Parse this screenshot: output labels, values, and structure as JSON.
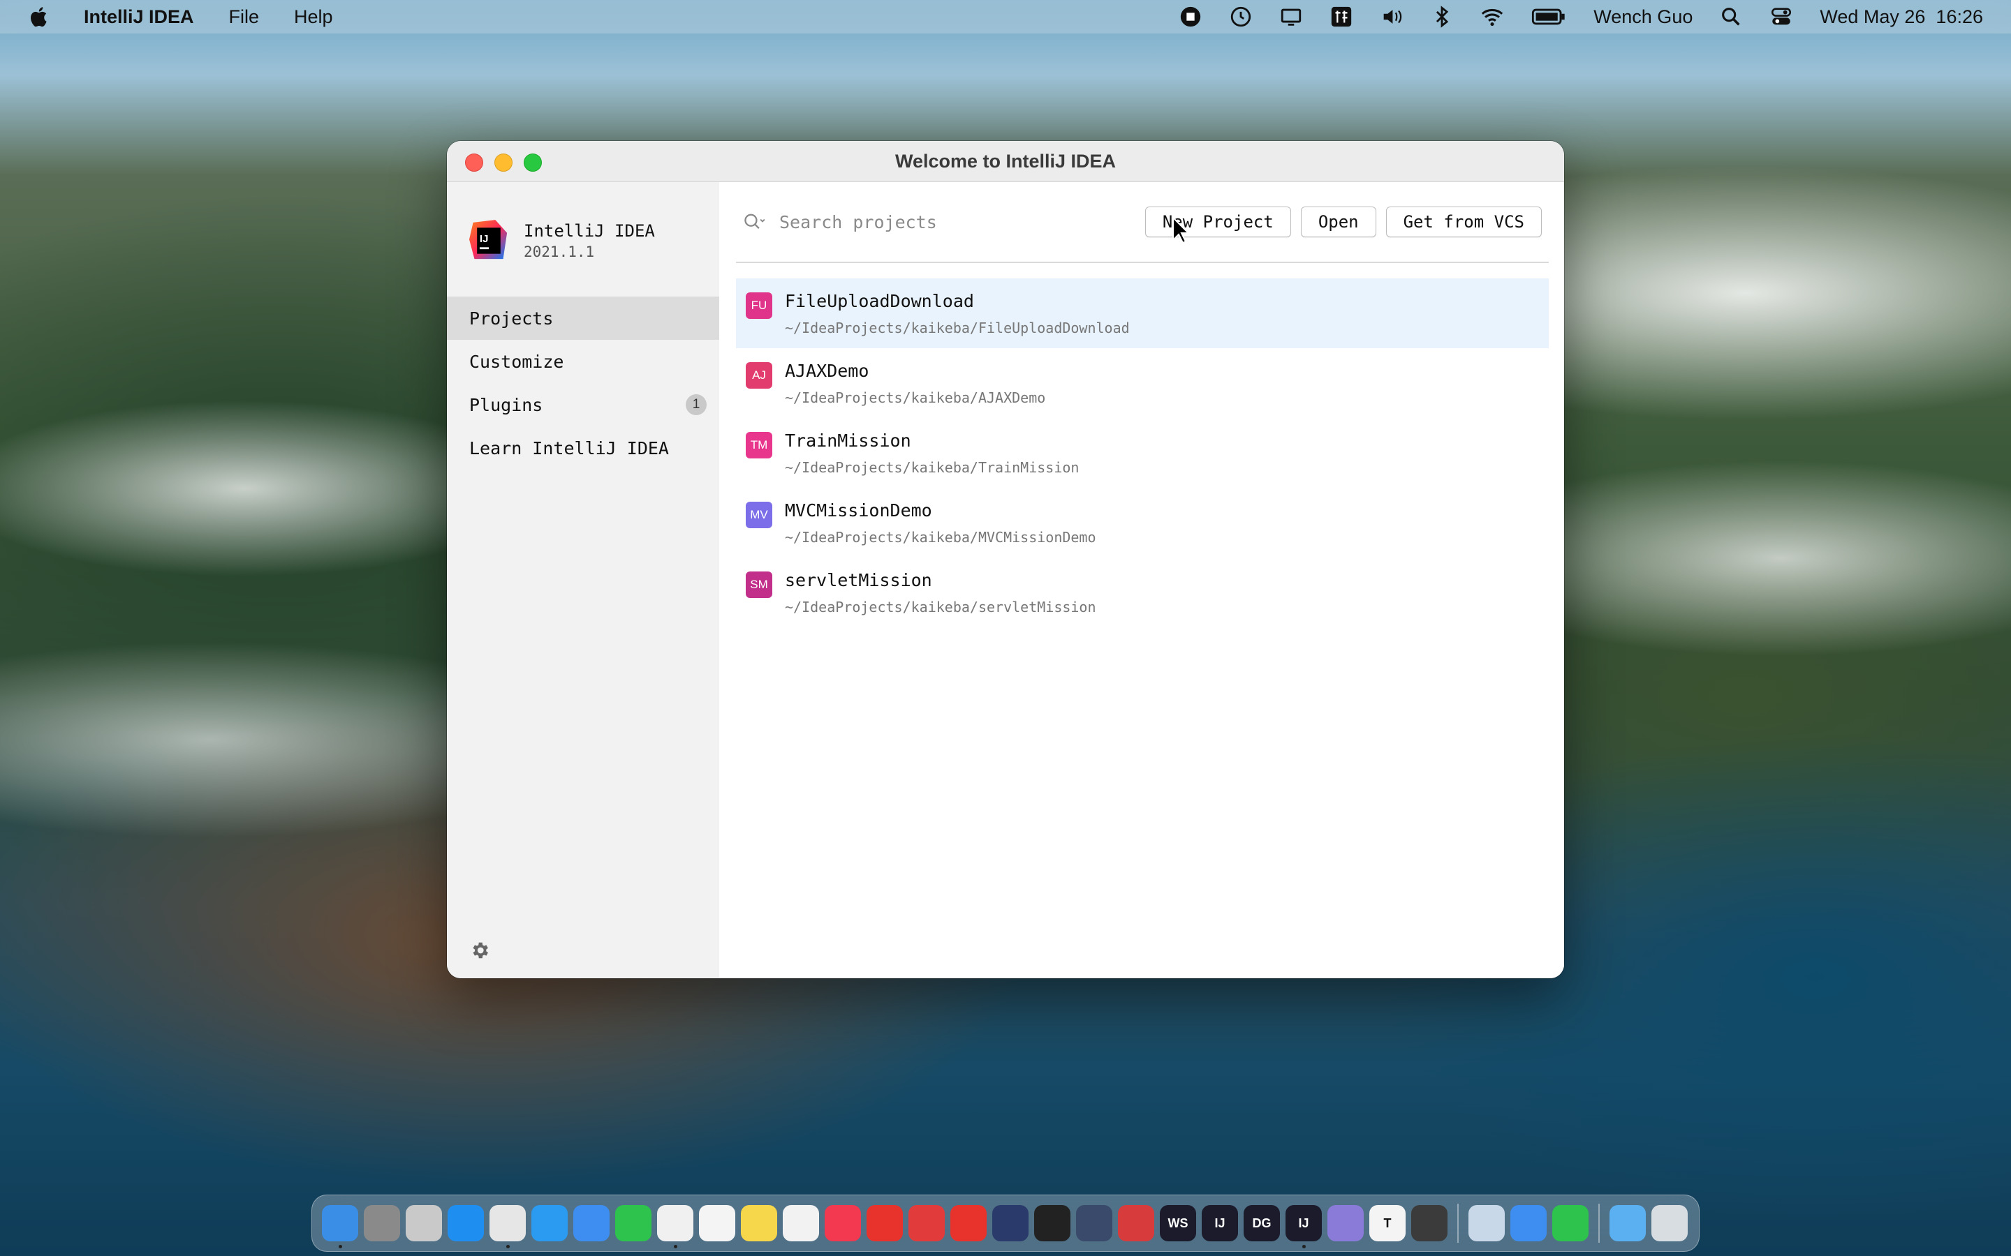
{
  "menubar": {
    "app_name": "IntelliJ IDEA",
    "menus": [
      "File",
      "Help"
    ],
    "user": "Wench Guo",
    "clock": "Wed May 26  16:26",
    "status_icons": [
      "record-stop-icon",
      "time-machine-icon",
      "display-icon",
      "input-method-icon",
      "volume-icon",
      "bluetooth-icon",
      "wifi-icon",
      "battery-icon",
      "spotlight-icon",
      "control-center-icon"
    ]
  },
  "window": {
    "title": "Welcome to IntelliJ IDEA"
  },
  "sidebar": {
    "product_name": "IntelliJ IDEA",
    "version": "2021.1.1",
    "items": [
      {
        "label": "Projects",
        "active": true
      },
      {
        "label": "Customize"
      },
      {
        "label": "Plugins",
        "badge": "1"
      },
      {
        "label": "Learn IntelliJ IDEA"
      }
    ]
  },
  "toolbar": {
    "search_placeholder": "Search projects",
    "new_project": "New Project",
    "open": "Open",
    "get_from_vcs": "Get from VCS"
  },
  "projects": [
    {
      "initials": "FU",
      "name": "FileUploadDownload",
      "path": "~/IdeaProjects/kaikeba/FileUploadDownload",
      "color": "#e0338a",
      "selected": true
    },
    {
      "initials": "AJ",
      "name": "AJAXDemo",
      "path": "~/IdeaProjects/kaikeba/AJAXDemo",
      "color": "#e23c6e"
    },
    {
      "initials": "TM",
      "name": "TrainMission",
      "path": "~/IdeaProjects/kaikeba/TrainMission",
      "color": "#e8368d"
    },
    {
      "initials": "MV",
      "name": "MVCMissionDemo",
      "path": "~/IdeaProjects/kaikeba/MVCMissionDemo",
      "color": "#7b6ee8"
    },
    {
      "initials": "SM",
      "name": "servletMission",
      "path": "~/IdeaProjects/kaikeba/servletMission",
      "color": "#c12f8a"
    }
  ],
  "dock": {
    "apps": [
      {
        "name": "finder",
        "color": "#3a8ee6"
      },
      {
        "name": "system-preferences",
        "color": "#8a8a8a"
      },
      {
        "name": "launchpad",
        "color": "#c9c9c9"
      },
      {
        "name": "app-store",
        "color": "#1f8ef1"
      },
      {
        "name": "chrome",
        "color": "#e6e6e6"
      },
      {
        "name": "safari",
        "color": "#2a9bf0"
      },
      {
        "name": "mail",
        "color": "#3d8ef0"
      },
      {
        "name": "wechat",
        "color": "#2dc34d"
      },
      {
        "name": "qq",
        "color": "#f0f0f0"
      },
      {
        "name": "photos",
        "color": "#f4f4f4"
      },
      {
        "name": "notes",
        "color": "#f6d64a"
      },
      {
        "name": "baidu-netdisk",
        "color": "#f2f2f2"
      },
      {
        "name": "music",
        "color": "#f2394f"
      },
      {
        "name": "app-red-1",
        "color": "#e8322c"
      },
      {
        "name": "netease-music",
        "color": "#e23b3b"
      },
      {
        "name": "app-red-2",
        "color": "#e8322c"
      },
      {
        "name": "video-app",
        "color": "#2a3b6b"
      },
      {
        "name": "terminal",
        "color": "#222222"
      },
      {
        "name": "app-dark",
        "color": "#3a4a6a"
      },
      {
        "name": "parallels",
        "color": "#d83b3b"
      },
      {
        "name": "webstorm",
        "color": "#1b1b2b",
        "label": "WS"
      },
      {
        "name": "intellij-1",
        "color": "#1b1b2b",
        "label": "IJ"
      },
      {
        "name": "datagrip",
        "color": "#1b1b2b",
        "label": "DG"
      },
      {
        "name": "intellij-2",
        "color": "#1b1b2b",
        "label": "IJ"
      },
      {
        "name": "app-purple",
        "color": "#8a7bd8"
      },
      {
        "name": "typora",
        "color": "#f4f4f4",
        "label": "T"
      },
      {
        "name": "sublime-text",
        "color": "#3b3b3b"
      },
      {
        "name": "preview",
        "color": "#c8d8e8"
      },
      {
        "name": "feishu",
        "color": "#3d8ef0"
      },
      {
        "name": "facetime",
        "color": "#2dc34d"
      },
      {
        "name": "folder",
        "color": "#5ab0f0"
      },
      {
        "name": "trash",
        "color": "#d8dde2"
      }
    ]
  }
}
